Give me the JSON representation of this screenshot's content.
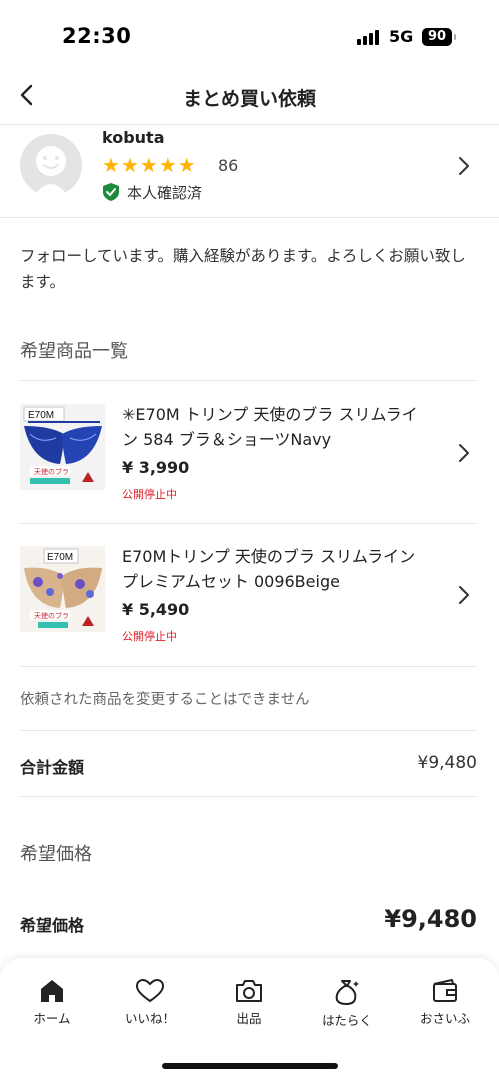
{
  "status_bar": {
    "time": "22:30",
    "network": "5G",
    "battery": "90"
  },
  "nav": {
    "title": "まとめ買い依頼"
  },
  "seller": {
    "name": "kobuta",
    "rating_stars": 5,
    "rating_count": "86",
    "verified_label": "本人確認済"
  },
  "message": "フォローしています。購入経験があります。よろしくお願い致します。",
  "items_section": {
    "heading": "希望商品一覧",
    "items": [
      {
        "name": "✳︎E70M トリンプ 天使のブラ スリムライン 584 ブラ＆ショーツNavy",
        "price": "¥ 3,990",
        "status": "公開停止中"
      },
      {
        "name": "E70Mトリンプ 天使のブラ スリムライン プレミアムセット 0096Beige",
        "price": "¥ 5,490",
        "status": "公開停止中"
      }
    ]
  },
  "note": "依頼された商品を変更することはできません",
  "total": {
    "label": "合計金額",
    "value": "¥9,480"
  },
  "desired_section": {
    "heading": "希望価格",
    "label": "希望価格",
    "value": "¥9,480"
  },
  "tab_bar": {
    "tabs": [
      {
        "label": "ホーム",
        "icon": "home-icon",
        "active": true
      },
      {
        "label": "いいね！",
        "icon": "heart-icon",
        "active": false
      },
      {
        "label": "出品",
        "icon": "camera-icon",
        "active": false
      },
      {
        "label": "はたらく",
        "icon": "money-bag-icon",
        "active": false
      },
      {
        "label": "おさいふ",
        "icon": "wallet-icon",
        "active": false
      }
    ]
  },
  "colors": {
    "star": "#ffb400",
    "verified": "#1d8a3c",
    "status_red": "#e0202b",
    "navy_item": "#1f3aa0"
  }
}
